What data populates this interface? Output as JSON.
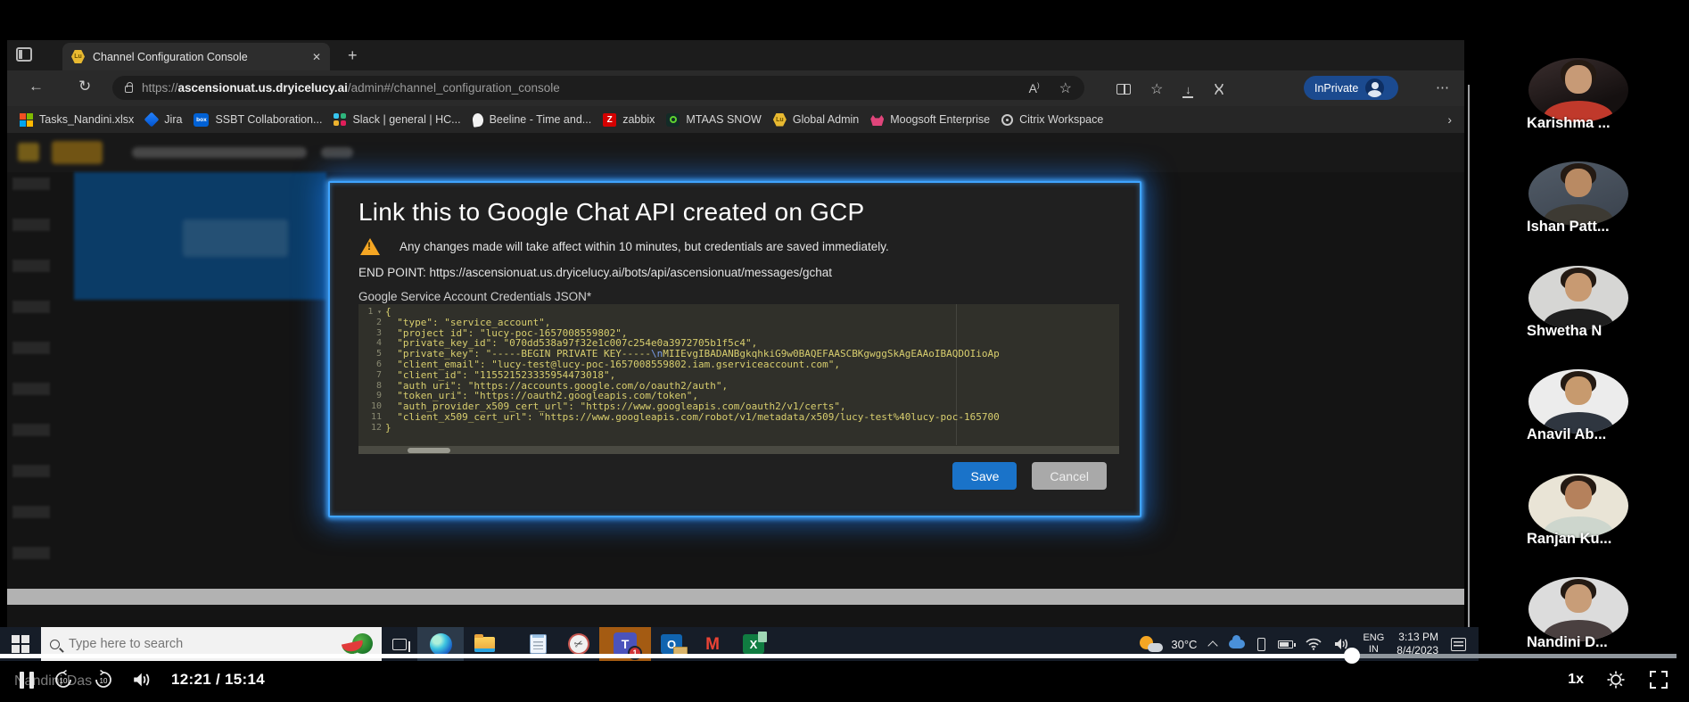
{
  "player": {
    "watermark": "Nandini Das",
    "time": "12:21 / 15:14",
    "speed": "1x",
    "progress_percent": "81%"
  },
  "participants": [
    {
      "name": "Karishma ..."
    },
    {
      "name": "Ishan Patt..."
    },
    {
      "name": "Shwetha N"
    },
    {
      "name": "Anavil Ab..."
    },
    {
      "name": "Ranjan Ku..."
    },
    {
      "name": "Nandini D..."
    }
  ],
  "browser": {
    "tab_title": "Channel Configuration Console",
    "url_scheme": "https://",
    "url_host": "ascensionuat.us.dryicelucy.ai",
    "url_path": "/admin#/channel_configuration_console",
    "inprivate": "InPrivate",
    "bookmarks": [
      {
        "label": "Tasks_Nandini.xlsx"
      },
      {
        "label": "Jira"
      },
      {
        "label": "SSBT Collaboration..."
      },
      {
        "label": "Slack | general | HC..."
      },
      {
        "label": "Beeline - Time and..."
      },
      {
        "label": "zabbix"
      },
      {
        "label": "MTAAS SNOW"
      },
      {
        "label": "Global Admin"
      },
      {
        "label": "Moogsoft Enterprise"
      },
      {
        "label": "Citrix Workspace"
      }
    ]
  },
  "dialog": {
    "title": "Link this to Google Chat API created on GCP",
    "warning": "Any changes made will take affect within 10 minutes, but credentials are saved immediately.",
    "endpoint": "END POINT: https://ascensionuat.us.dryicelucy.ai/bots/api/ascensionuat/messages/gchat",
    "field_label": "Google Service Account Credentials JSON*",
    "save": "Save",
    "cancel": "Cancel",
    "code": {
      "lines": [
        {
          "pre": "{",
          "esc": "",
          "post": ""
        },
        {
          "pre": "  \"type\": \"service_account\",",
          "esc": "",
          "post": ""
        },
        {
          "pre": "  \"project_id\": \"lucy-poc-1657008559802\",",
          "esc": "",
          "post": ""
        },
        {
          "pre": "  \"private_key_id\": \"070dd538a97f32e1c007c254e0a3972705b1f5c4\",",
          "esc": "",
          "post": ""
        },
        {
          "pre": "  \"private_key\": \"-----BEGIN PRIVATE KEY-----",
          "esc": "\\n",
          "post": "MIIEvgIBADANBgkqhkiG9w0BAQEFAASCBKgwggSkAgEAAoIBAQDOIioAp"
        },
        {
          "pre": "  \"client_email\": \"lucy-test@lucy-poc-1657008559802.iam.gserviceaccount.com\",",
          "esc": "",
          "post": ""
        },
        {
          "pre": "  \"client_id\": \"115521523335954473018\",",
          "esc": "",
          "post": ""
        },
        {
          "pre": "  \"auth_uri\": \"https://accounts.google.com/o/oauth2/auth\",",
          "esc": "",
          "post": ""
        },
        {
          "pre": "  \"token_uri\": \"https://oauth2.googleapis.com/token\",",
          "esc": "",
          "post": ""
        },
        {
          "pre": "  \"auth_provider_x509_cert_url\": \"https://www.googleapis.com/oauth2/v1/certs\",",
          "esc": "",
          "post": ""
        },
        {
          "pre": "  \"client_x509_cert_url\": \"https://www.googleapis.com/robot/v1/metadata/x509/lucy-test%40lucy-poc-165700",
          "esc": "",
          "post": ""
        },
        {
          "pre": "}",
          "esc": "",
          "post": ""
        }
      ]
    }
  },
  "taskbar": {
    "search_placeholder": "Type here to search",
    "temperature": "30°C",
    "lang_top": "ENG",
    "lang_bottom": "IN",
    "clock_time": "3:13 PM",
    "clock_date": "8/4/2023",
    "teams_badge": "1"
  },
  "colors": {
    "modal_glow": "#3fa4ff",
    "save_button": "#1a73c9",
    "code_text": "#d8ce6e",
    "teams_highlight": "#a45b12"
  }
}
